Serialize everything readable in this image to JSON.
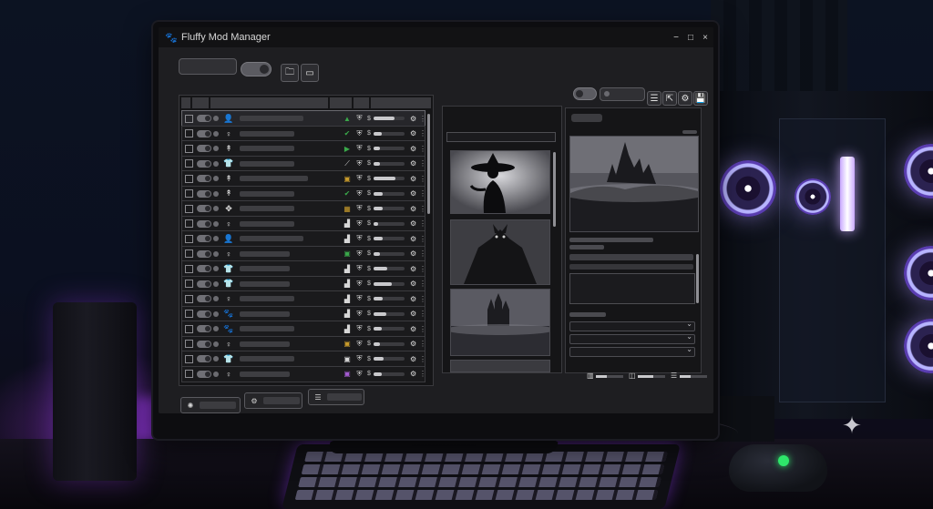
{
  "window": {
    "title": "Fluffy Mod Manager",
    "app_icon": "paw-icon",
    "controls": [
      "−",
      "□",
      "×"
    ]
  },
  "toolbar": {
    "folder_icon": "folder-icon",
    "window_icon": "window-icon"
  },
  "right_toolbar_icons": [
    "list-icon",
    "export-icon",
    "gear-icon",
    "save-icon"
  ],
  "mod_list": {
    "rows": [
      {
        "icon": "👤",
        "icon_name": "person-icon",
        "status": "▲",
        "status_color": "#3aa84a",
        "progress": 0.68,
        "name_len": 0.7,
        "selected": true
      },
      {
        "icon": "♀",
        "icon_name": "female-icon",
        "status": "✔",
        "status_color": "#3aa84a",
        "progress": 0.25,
        "name_len": 0.6
      },
      {
        "icon": "↟",
        "icon_name": "figure-icon",
        "status": "▶",
        "status_color": "#3aa84a",
        "progress": 0.22,
        "name_len": 0.6
      },
      {
        "icon": "👕",
        "icon_name": "shirt-icon",
        "status": "⟋",
        "status_color": "#d7d7d7",
        "progress": 0.2,
        "name_len": 0.6
      },
      {
        "icon": "↟",
        "icon_name": "figure-icon",
        "status": "▣",
        "status_color": "#c79a2b",
        "progress": 0.7,
        "name_len": 0.75
      },
      {
        "icon": "↟",
        "icon_name": "figure-icon",
        "status": "✔",
        "status_color": "#3aa84a",
        "progress": 0.3,
        "name_len": 0.6
      },
      {
        "icon": "✥",
        "icon_name": "move-icon",
        "status": "▦",
        "status_color": "#c79a2b",
        "progress": 0.3,
        "name_len": 0.6
      },
      {
        "icon": "♀",
        "icon_name": "female-icon",
        "status": "▟",
        "status_color": "#d7d7d7",
        "progress": 0.15,
        "name_len": 0.6
      },
      {
        "icon": "👤",
        "icon_name": "person-icon",
        "status": "▟",
        "status_color": "#d7d7d7",
        "progress": 0.3,
        "name_len": 0.7
      },
      {
        "icon": "♀",
        "icon_name": "female-icon",
        "status": "▣",
        "status_color": "#3aa84a",
        "progress": 0.2,
        "name_len": 0.55
      },
      {
        "icon": "👕",
        "icon_name": "shirt-icon",
        "status": "▟",
        "status_color": "#d7d7d7",
        "progress": 0.45,
        "name_len": 0.55
      },
      {
        "icon": "👕",
        "icon_name": "shirt-icon",
        "status": "▟",
        "status_color": "#d7d7d7",
        "progress": 0.6,
        "name_len": 0.55
      },
      {
        "icon": "♀",
        "icon_name": "female-icon",
        "status": "▟",
        "status_color": "#d7d7d7",
        "progress": 0.28,
        "name_len": 0.6
      },
      {
        "icon": "🐾",
        "icon_name": "paw-icon",
        "status": "▟",
        "status_color": "#d7d7d7",
        "progress": 0.4,
        "name_len": 0.55
      },
      {
        "icon": "🐾",
        "icon_name": "paw-icon",
        "status": "▟",
        "status_color": "#d7d7d7",
        "progress": 0.25,
        "name_len": 0.6
      },
      {
        "icon": "♀",
        "icon_name": "female-icon",
        "status": "▣",
        "status_color": "#c79a2b",
        "progress": 0.2,
        "name_len": 0.55
      },
      {
        "icon": "👕",
        "icon_name": "shirt-icon",
        "status": "▣",
        "status_color": "#d7d7d7",
        "progress": 0.32,
        "name_len": 0.6
      },
      {
        "icon": "♀",
        "icon_name": "female-icon",
        "status": "▣",
        "status_color": "#a35bd0",
        "progress": 0.25,
        "name_len": 0.55
      }
    ]
  },
  "gallery": {
    "images": [
      "witch-silhouette-image",
      "werewolf-image",
      "castle-image"
    ]
  },
  "preview": {
    "image": "dark-castle-image"
  },
  "bottom_bar": {
    "icons": [
      "sparkle-gear-icon",
      "gear-icon",
      "list-icon"
    ]
  },
  "view_controls": {
    "slider_levels": [
      0.4,
      0.55,
      0.4
    ]
  }
}
